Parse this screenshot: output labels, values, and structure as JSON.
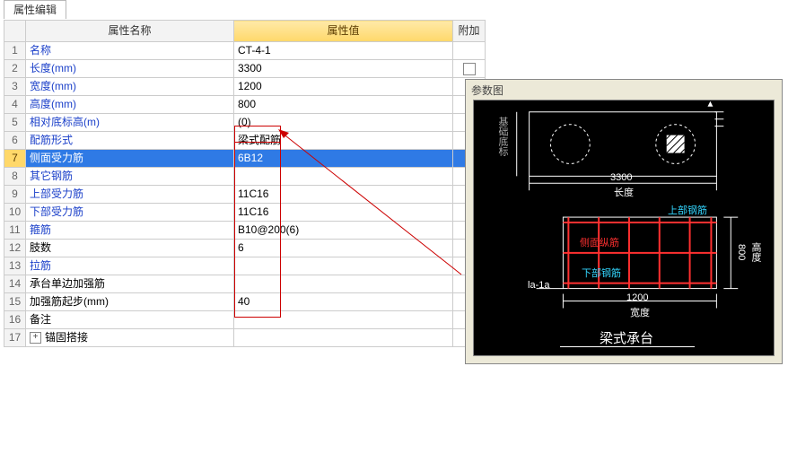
{
  "tab_label": "属性编辑",
  "columns": {
    "name": "属性名称",
    "value": "属性值",
    "extra": "附加"
  },
  "rows": [
    {
      "idx": 1,
      "name": "名称",
      "value": "CT-4-1",
      "blue": true
    },
    {
      "idx": 2,
      "name": "长度(mm)",
      "value": "3300",
      "blue": true,
      "ext_chk": true
    },
    {
      "idx": 3,
      "name": "宽度(mm)",
      "value": "1200",
      "blue": true
    },
    {
      "idx": 4,
      "name": "高度(mm)",
      "value": "800",
      "blue": true
    },
    {
      "idx": 5,
      "name": "相对底标高(m)",
      "value": "(0)",
      "blue": true
    },
    {
      "idx": 6,
      "name": "配筋形式",
      "value": "梁式配筋",
      "blue": true
    },
    {
      "idx": 7,
      "name": "侧面受力筋",
      "value": "6B12",
      "blue": true,
      "selected": true
    },
    {
      "idx": 8,
      "name": "其它钢筋",
      "value": "",
      "blue": true
    },
    {
      "idx": 9,
      "name": "上部受力筋",
      "value": "11C16",
      "blue": true
    },
    {
      "idx": 10,
      "name": "下部受力筋",
      "value": "11C16",
      "blue": true
    },
    {
      "idx": 11,
      "name": "箍筋",
      "value": "B10@200(6)",
      "blue": true
    },
    {
      "idx": 12,
      "name": "肢数",
      "value": "6",
      "blue": false
    },
    {
      "idx": 13,
      "name": "拉筋",
      "value": "",
      "blue": true
    },
    {
      "idx": 14,
      "name": "承台单边加强筋",
      "value": "",
      "blue": false
    },
    {
      "idx": 15,
      "name": "加强筋起步(mm)",
      "value": "40",
      "blue": false
    },
    {
      "idx": 16,
      "name": "备注",
      "value": "",
      "blue": false
    },
    {
      "idx": 17,
      "name": "锚固搭接",
      "value": "",
      "blue": false,
      "expander": true
    }
  ],
  "panel": {
    "title": "参数图",
    "dims": {
      "len": "3300",
      "len_label": "长度",
      "wid": "1200",
      "wid_label": "宽度",
      "h": "800",
      "h_label": "高度"
    },
    "labels": {
      "top_bar": "上部钢筋",
      "side_bar": "侧面纵筋",
      "bot_bar": "下部钢筋",
      "base": "基础底标",
      "extent": "la-1a"
    },
    "caption": "梁式承台"
  }
}
